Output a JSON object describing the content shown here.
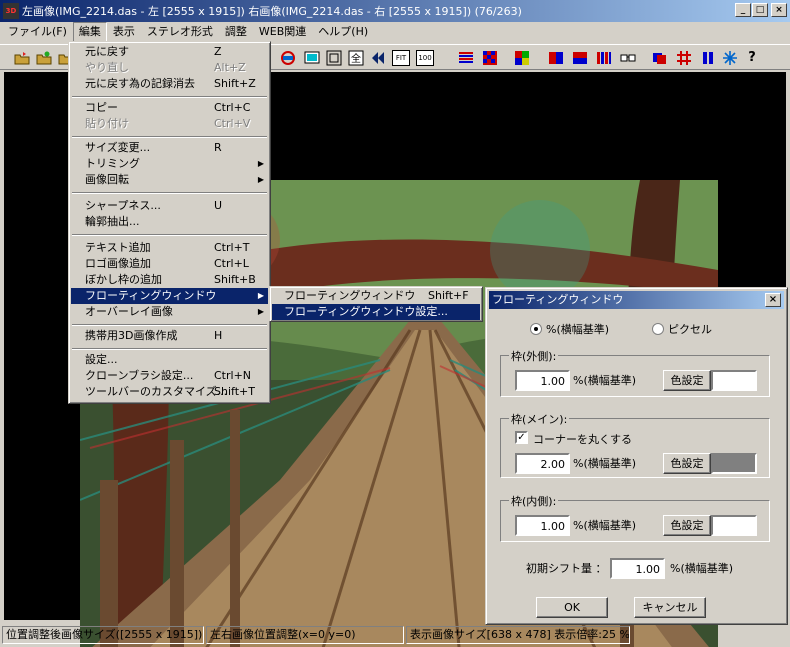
{
  "window": {
    "icon_text": "3D",
    "title": "左画像(IMG_2214.das - 左 [2555 x 1915]) 右画像(IMG_2214.das - 右 [2555 x 1915])  (76/263)",
    "minimize": "_",
    "maximize": "□",
    "close": "×"
  },
  "menubar": [
    {
      "label": "ファイル(F)"
    },
    {
      "label": "編集"
    },
    {
      "label": "表示"
    },
    {
      "label": "ステレオ形式"
    },
    {
      "label": "調整"
    },
    {
      "label": "WEB関連"
    },
    {
      "label": "ヘルプ(H)"
    }
  ],
  "toolbar": {
    "icons": [
      "open-folder-icon",
      "open-folder-alt-icon",
      "save-icon",
      "rotate-icon",
      "monitor-icon",
      "frame-icon",
      "fullscreen-icon",
      "prev-icon",
      "fit-icon",
      "zoom-100-icon",
      "stripes-red-blue-icon",
      "checker-icon",
      "mosaic-icon",
      "split-red-blue-icon",
      "split-blue-red-icon",
      "columns-icon",
      "glasses-icon",
      "red-blue-overlay-icon",
      "grid-hash-icon",
      "parallel-icon",
      "snowflake-icon",
      "help-icon"
    ],
    "fit_label": "FIT",
    "zoom_label": "100",
    "help_label": "?"
  },
  "edit_menu": {
    "items": [
      {
        "label": "元に戻す",
        "shortcut": "Z",
        "disabled": false
      },
      {
        "label": "やり直し",
        "shortcut": "Alt+Z",
        "disabled": true
      },
      {
        "label": "元に戻す為の記録消去",
        "shortcut": "Shift+Z",
        "disabled": false
      },
      {
        "label": "コピー",
        "shortcut": "Ctrl+C",
        "disabled": false
      },
      {
        "label": "貼り付け",
        "shortcut": "Ctrl+V",
        "disabled": true
      },
      {
        "label": "サイズ変更...",
        "shortcut": "R",
        "disabled": false
      },
      {
        "label": "トリミング",
        "shortcut": "",
        "submenu": true
      },
      {
        "label": "画像回転",
        "shortcut": "",
        "submenu": true
      },
      {
        "label": "シャープネス...",
        "shortcut": "U",
        "disabled": false
      },
      {
        "label": "輪郭抽出...",
        "shortcut": "",
        "disabled": false
      },
      {
        "label": "テキスト追加",
        "shortcut": "Ctrl+T",
        "disabled": false
      },
      {
        "label": "ロゴ画像追加",
        "shortcut": "Ctrl+L",
        "disabled": false
      },
      {
        "label": "ぼかし枠の追加",
        "shortcut": "Shift+B",
        "disabled": false
      },
      {
        "label": "フローティングウィンドウ",
        "shortcut": "",
        "submenu": true,
        "highlight": true
      },
      {
        "label": "オーバーレイ画像",
        "shortcut": "",
        "submenu": true
      },
      {
        "label": "携帯用3D画像作成",
        "shortcut": "H",
        "disabled": false
      },
      {
        "label": "設定...",
        "shortcut": "",
        "disabled": false
      },
      {
        "label": "クローンブラシ設定...",
        "shortcut": "Ctrl+N",
        "disabled": false
      },
      {
        "label": "ツールバーのカスタマイズ...",
        "shortcut": "Shift+T",
        "disabled": false
      }
    ]
  },
  "submenu": {
    "items": [
      {
        "label": "フローティングウィンドウ",
        "shortcut": "Shift+F"
      },
      {
        "label": "フローティングウィンドウ設定...",
        "shortcut": ""
      }
    ]
  },
  "dialog": {
    "title": "フローティングウィンドウ",
    "close": "×",
    "radio_percent": "%(横幅基準)",
    "radio_pixel": "ピクセル",
    "outer": {
      "label": "枠(外側):",
      "value": "1.00",
      "unit": "%(横幅基準)",
      "color_btn": "色設定",
      "color": "#ffffff"
    },
    "main": {
      "label": "枠(メイン):",
      "rounded_label": "コーナーを丸くする",
      "check": "✓",
      "value": "2.00",
      "unit": "%(横幅基準)",
      "color_btn": "色設定",
      "color": "#808080"
    },
    "inner": {
      "label": "枠(内側):",
      "value": "1.00",
      "unit": "%(横幅基準)",
      "color_btn": "色設定",
      "color": "#ffffff"
    },
    "shift_label": "初期シフト量  ：",
    "shift_value": "1.00",
    "shift_unit": "%(横幅基準)",
    "ok": "OK",
    "cancel": "キャンセル"
  },
  "status": {
    "cell1": "位置調整後画像サイズ([2555 x 1915])",
    "cell2": "左右画像位置調整(x=0 y=0)",
    "cell3": "表示画像サイズ[638 x 478]  表示倍率:25 %"
  }
}
